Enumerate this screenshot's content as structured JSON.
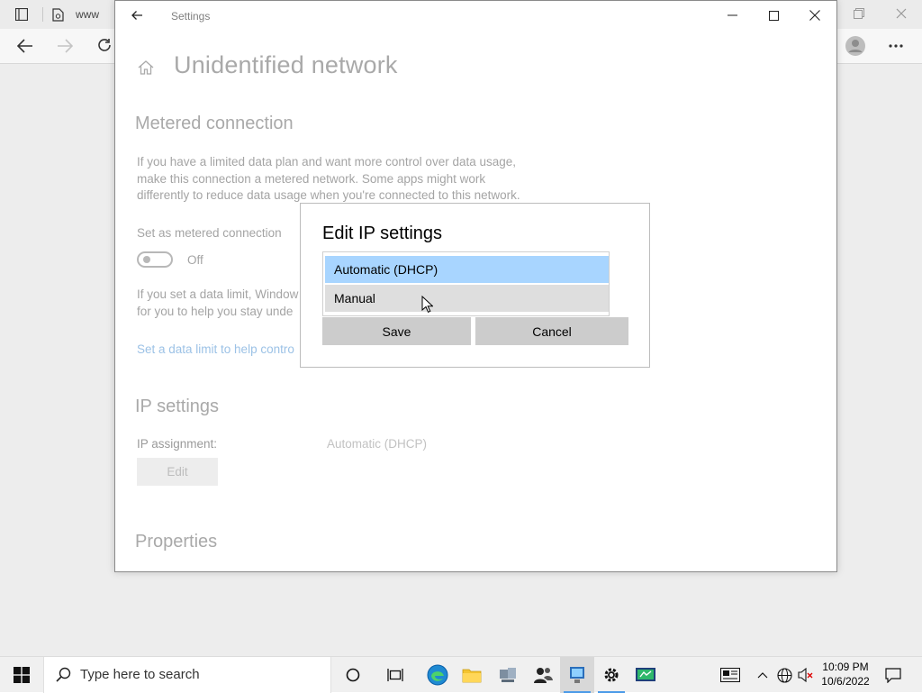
{
  "browser": {
    "tab_text": "www"
  },
  "settings": {
    "window_title": "Settings",
    "page_title": "Unidentified network",
    "metered": {
      "heading": "Metered connection",
      "description_lines": [
        "If you have a limited data plan and want more control over data usage,",
        "make this connection a metered network. Some apps might work",
        "differently to reduce data usage when you're connected to this network."
      ],
      "toggle_label": "Set as metered connection",
      "toggle_state": "Off",
      "data_limit_lines": [
        "If you set a data limit, Window",
        "for you to help you stay unde"
      ],
      "link": "Set a data limit to help contro"
    },
    "ip": {
      "heading": "IP settings",
      "assignment_label": "IP assignment:",
      "assignment_value": "Automatic (DHCP)",
      "edit_label": "Edit"
    },
    "properties_heading": "Properties"
  },
  "dialog": {
    "title": "Edit IP settings",
    "options": [
      "Automatic (DHCP)",
      "Manual"
    ],
    "selected": "Automatic (DHCP)",
    "hovered": "Manual",
    "save_label": "Save",
    "cancel_label": "Cancel"
  },
  "taskbar": {
    "search_placeholder": "Type here to search",
    "time": "10:09 PM",
    "date": "10/6/2022"
  },
  "colors": {
    "selected_option": "#a8d5ff",
    "hover_option": "#dedede",
    "button_bg": "#cccccc",
    "taskbar_accent": "#4c9be8"
  }
}
